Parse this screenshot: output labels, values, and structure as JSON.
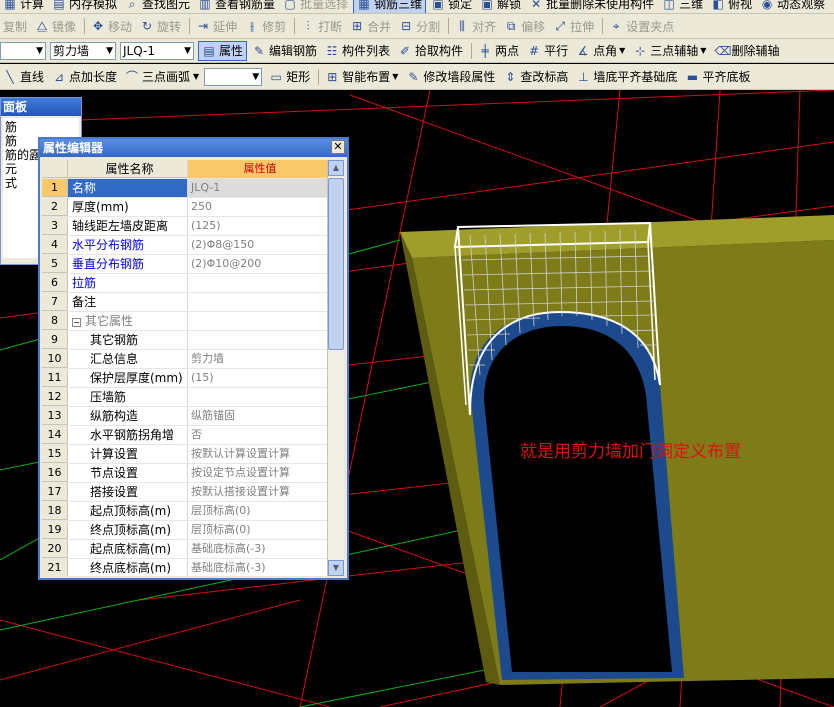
{
  "toolbar1": {
    "items": [
      "复制",
      "镜像",
      "移动",
      "旋转",
      "延伸",
      "修剪",
      "打断",
      "合并",
      "分割",
      "对齐",
      "偏移",
      "拉伸",
      "设置夹点"
    ]
  },
  "toolbar0": {
    "items": [
      "计算",
      "内存模拟",
      "查找图元",
      "查看钢筋量",
      "批量选择",
      "钢筋三维",
      "锁定",
      "解锁",
      "批量删除未使用构件",
      "三维",
      "俯视",
      "动态观察"
    ]
  },
  "toolbar2": {
    "type_combo": "剪力墙",
    "name_combo": "JLQ-1",
    "buttons": [
      "属性",
      "编辑钢筋",
      "构件列表",
      "拾取构件",
      "两点",
      "平行",
      "点角",
      "三点辅轴",
      "删除辅轴"
    ]
  },
  "toolbar3": {
    "buttons": [
      "直线",
      "点加长度",
      "三点画弧",
      "矩形",
      "智能布置",
      "修改墙段属性",
      "查改标高",
      "墙底平齐基础底",
      "平齐底板"
    ]
  },
  "left_panel": {
    "title": "面板",
    "lines": [
      "筋",
      "筋",
      "筋的露出",
      "元",
      "式"
    ]
  },
  "prop_editor": {
    "title": "属性编辑器",
    "col_name": "属性名称",
    "col_value": "属性值",
    "rows": [
      {
        "num": "1",
        "name": "名称",
        "value": "JLQ-1"
      },
      {
        "num": "2",
        "name": "厚度(mm)",
        "value": "250"
      },
      {
        "num": "3",
        "name": "轴线距左墙皮距离",
        "value": "(125)"
      },
      {
        "num": "4",
        "name": "水平分布钢筋",
        "value": "(2)Φ8@150"
      },
      {
        "num": "5",
        "name": "垂直分布钢筋",
        "value": "(2)Φ10@200"
      },
      {
        "num": "6",
        "name": "拉筋",
        "value": ""
      },
      {
        "num": "7",
        "name": "备注",
        "value": ""
      },
      {
        "num": "8",
        "name": "其它属性",
        "value": ""
      },
      {
        "num": "9",
        "name": "其它钢筋",
        "value": ""
      },
      {
        "num": "10",
        "name": "汇总信息",
        "value": "剪力墙"
      },
      {
        "num": "11",
        "name": "保护层厚度(mm)",
        "value": "(15)"
      },
      {
        "num": "12",
        "name": "压墙筋",
        "value": ""
      },
      {
        "num": "13",
        "name": "纵筋构造",
        "value": "纵筋锚固"
      },
      {
        "num": "14",
        "name": "水平钢筋拐角增",
        "value": "否"
      },
      {
        "num": "15",
        "name": "计算设置",
        "value": "按默认计算设置计算"
      },
      {
        "num": "16",
        "name": "节点设置",
        "value": "按设定节点设置计算"
      },
      {
        "num": "17",
        "name": "搭接设置",
        "value": "按默认搭接设置计算"
      },
      {
        "num": "18",
        "name": "起点顶标高(m)",
        "value": "层顶标高(0)"
      },
      {
        "num": "19",
        "name": "终点顶标高(m)",
        "value": "层顶标高(0)"
      },
      {
        "num": "20",
        "name": "起点底标高(m)",
        "value": "基础底标高(-3)"
      },
      {
        "num": "21",
        "name": "终点底标高(m)",
        "value": "基础底标高(-3)"
      }
    ]
  },
  "annotation": "就是用剪力墙加门洞定义布置",
  "colors": {
    "wall": "#7e7c19",
    "wall_dark": "#5e5c10",
    "opening_edge": "#1c4a8c",
    "cage": "#ffffff",
    "grid_red": "#d01010",
    "grid_green": "#10b010"
  }
}
